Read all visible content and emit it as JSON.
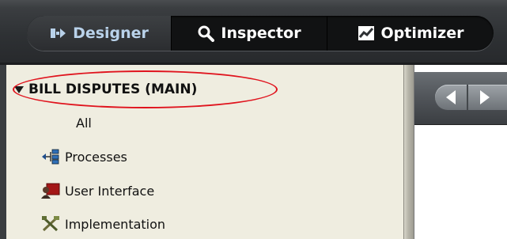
{
  "toolbar": {
    "tabs": [
      {
        "label": "Designer",
        "icon": "designer-icon",
        "selected": true
      },
      {
        "label": "Inspector",
        "icon": "magnifier-icon",
        "selected": false
      },
      {
        "label": "Optimizer",
        "icon": "chart-icon",
        "selected": false
      }
    ]
  },
  "tree": {
    "root_label": "BILL DISPUTES (MAIN)",
    "items": [
      {
        "label": "All",
        "icon": null
      },
      {
        "label": "Processes",
        "icon": "processes-icon"
      },
      {
        "label": "User Interface",
        "icon": "user-interface-icon"
      },
      {
        "label": "Implementation",
        "icon": "implementation-icon"
      }
    ]
  },
  "colors": {
    "annotation": "#e0141e",
    "selected_tab_text": "#b9d2ea",
    "panel_bg": "#efede0",
    "topbar": "#2e3134"
  }
}
